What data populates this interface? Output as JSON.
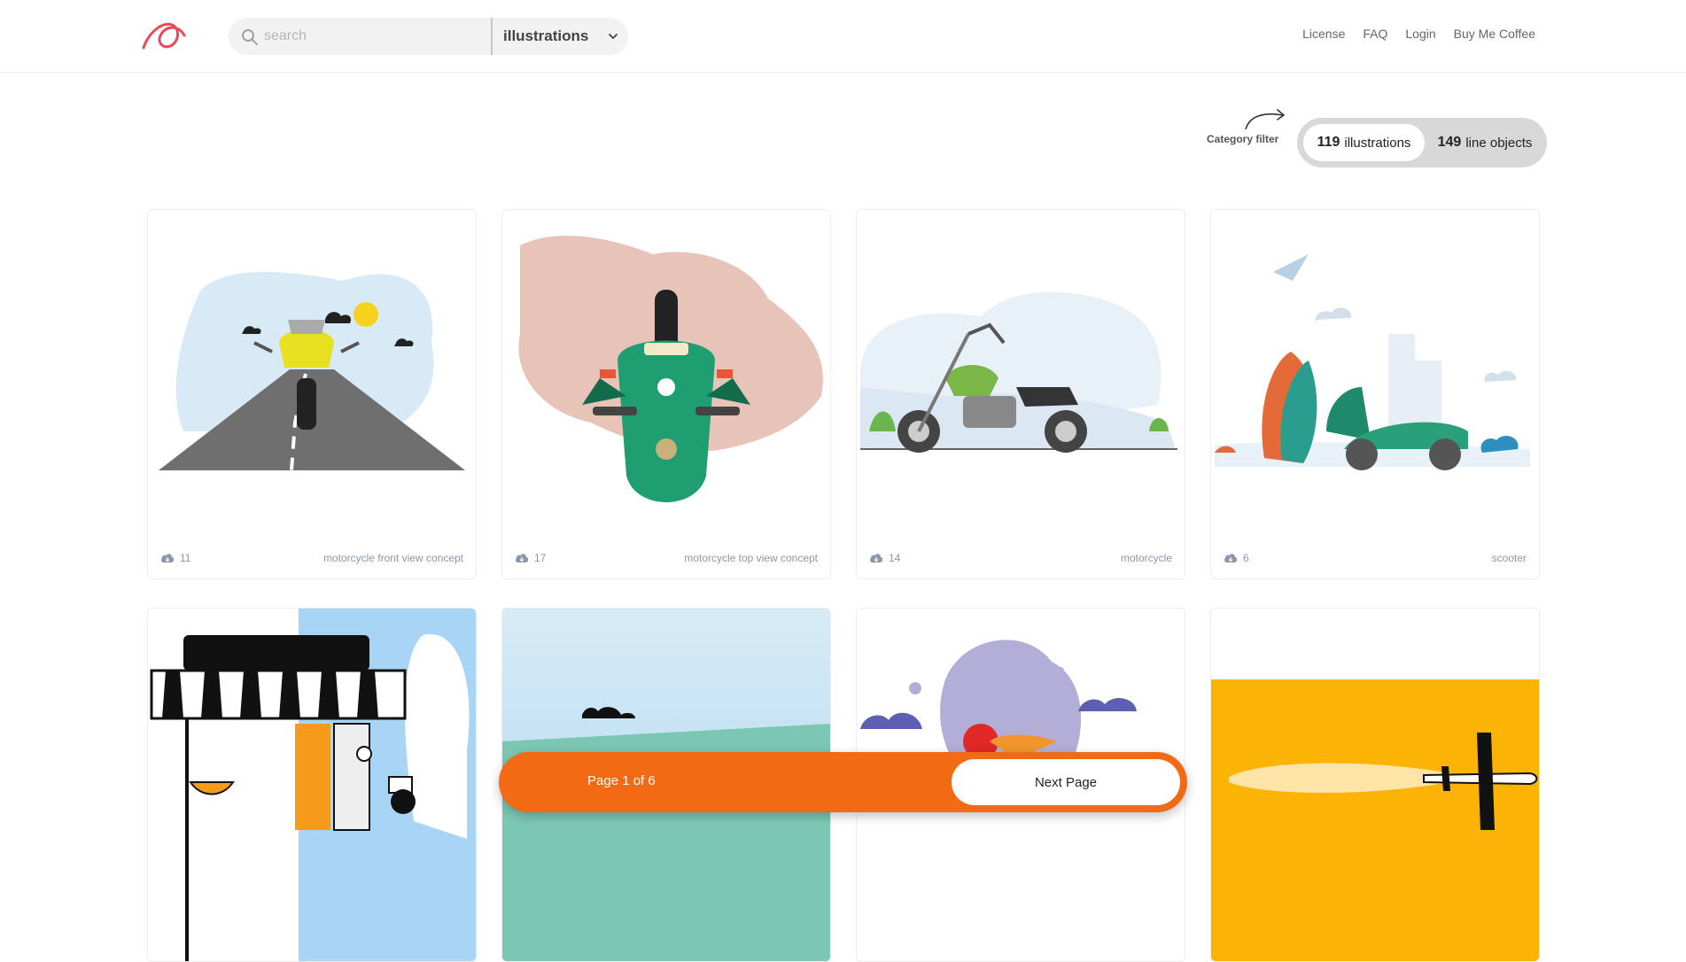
{
  "header": {
    "search": {
      "placeholder": "search",
      "value": ""
    },
    "category_select": "illustrations",
    "nav": [
      "License",
      "FAQ",
      "Login",
      "Buy Me Coffee"
    ]
  },
  "filter": {
    "label": "Category filter",
    "options": [
      {
        "count": "119",
        "label": "illustrations",
        "active": true
      },
      {
        "count": "149",
        "label": "line objects",
        "active": false
      }
    ]
  },
  "cards": [
    {
      "downloads": "11",
      "title": "motorcycle front view concept"
    },
    {
      "downloads": "17",
      "title": "motorcycle top view concept"
    },
    {
      "downloads": "14",
      "title": "motorcycle"
    },
    {
      "downloads": "6",
      "title": "scooter"
    }
  ],
  "pager": {
    "info": "Page 1 of 6",
    "next_label": "Next Page"
  },
  "colors": {
    "brand": "#e8485a",
    "accent": "#f26a14"
  }
}
